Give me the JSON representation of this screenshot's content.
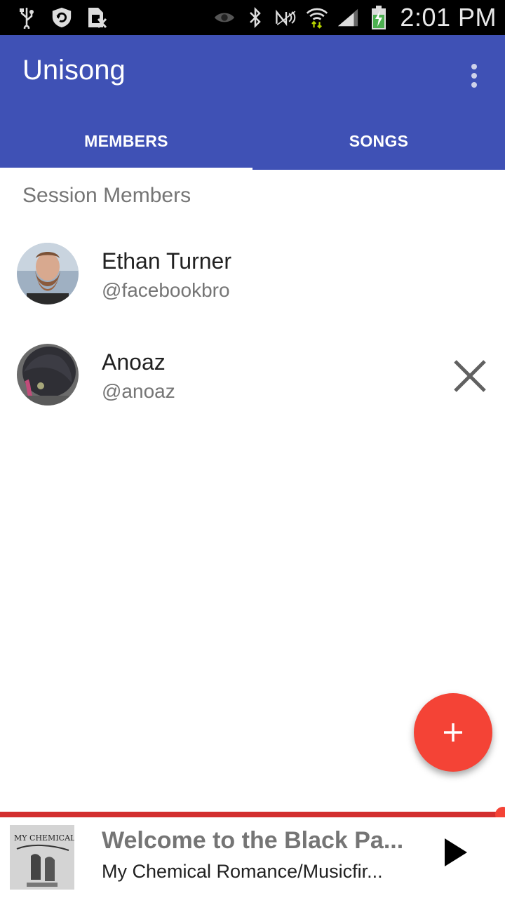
{
  "status_bar": {
    "time": "2:01 PM",
    "icons": [
      "usb-icon",
      "shield-refresh-icon",
      "sim-card-off-icon",
      "eye-icon",
      "bluetooth-icon",
      "nfc-icon",
      "wifi-icon",
      "signal-icon",
      "battery-charging-icon"
    ]
  },
  "app_bar": {
    "title": "Unisong",
    "overflow_icon": "more-vert-icon"
  },
  "tabs": [
    {
      "label": "MEMBERS",
      "selected": true
    },
    {
      "label": "SONGS",
      "selected": false
    }
  ],
  "members_section": {
    "header": "Session Members",
    "members": [
      {
        "name": "Ethan Turner",
        "handle": "@facebookbro",
        "removable": false
      },
      {
        "name": "Anoaz",
        "handle": "@anoaz",
        "removable": true
      }
    ]
  },
  "fab": {
    "icon": "add-icon"
  },
  "player": {
    "track_title": "Welcome to the Black Pa...",
    "track_artist": "My Chemical Romance/Musicfir...",
    "album_art_text": "MY CHEMICAL ROMANCE",
    "play_icon": "play-icon",
    "progress_fraction": 0.99
  },
  "colors": {
    "primary": "#3f51b5",
    "accent": "#f44336",
    "progress": "#d32f2f"
  }
}
